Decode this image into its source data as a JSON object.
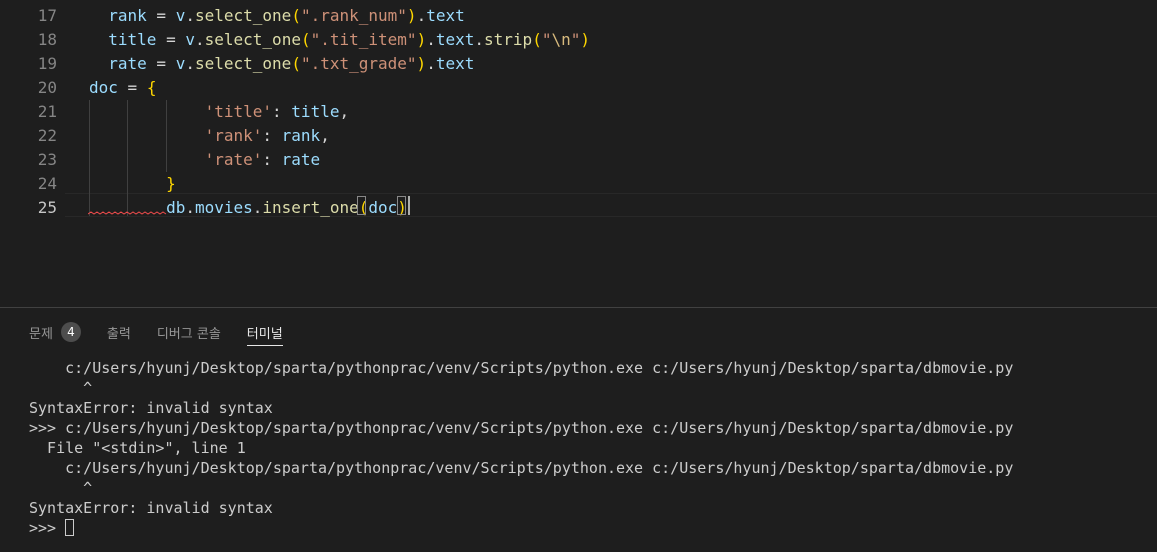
{
  "editor": {
    "line_numbers": [
      "17",
      "18",
      "19",
      "20",
      "21",
      "22",
      "23",
      "24",
      "25"
    ],
    "lines": {
      "l17": [
        "rank",
        " = ",
        "v",
        ".",
        "select_one",
        "(",
        "\".rank_num\"",
        ")",
        ".",
        "text"
      ],
      "l18": [
        "title",
        " = ",
        "v",
        ".",
        "select_one",
        "(",
        "\".tit_item\"",
        ")",
        ".",
        "text",
        ".",
        "strip",
        "(",
        "\"",
        "\\n",
        "\"",
        ")"
      ],
      "l19": [
        "rate",
        " = ",
        "v",
        ".",
        "select_one",
        "(",
        "\".txt_grade\"",
        ")",
        ".",
        "text"
      ],
      "l20": [
        "doc",
        " = ",
        "{"
      ],
      "l21": [
        "'title'",
        ": ",
        "title",
        ","
      ],
      "l22": [
        "'rank'",
        ": ",
        "rank",
        ","
      ],
      "l23": [
        "'rate'",
        ": ",
        "rate"
      ],
      "l24": [
        "}"
      ],
      "l25": [
        "db",
        ".",
        "movies",
        ".",
        "insert_one",
        "(",
        "doc",
        ")"
      ]
    }
  },
  "panel": {
    "tabs": {
      "problems": "문제",
      "problems_count": "4",
      "output": "출력",
      "debug_console": "디버그 콘솔",
      "terminal": "터미널"
    },
    "terminal_lines": [
      "    c:/Users/hyunj/Desktop/sparta/pythonprac/venv/Scripts/python.exe c:/Users/hyunj/Desktop/sparta/dbmovie.py",
      "      ^",
      "SyntaxError: invalid syntax",
      ">>> c:/Users/hyunj/Desktop/sparta/pythonprac/venv/Scripts/python.exe c:/Users/hyunj/Desktop/sparta/dbmovie.py",
      "  File \"<stdin>\", line 1",
      "    c:/Users/hyunj/Desktop/sparta/pythonprac/venv/Scripts/python.exe c:/Users/hyunj/Desktop/sparta/dbmovie.py",
      "      ^",
      "SyntaxError: invalid syntax"
    ],
    "prompt": ">>> "
  }
}
